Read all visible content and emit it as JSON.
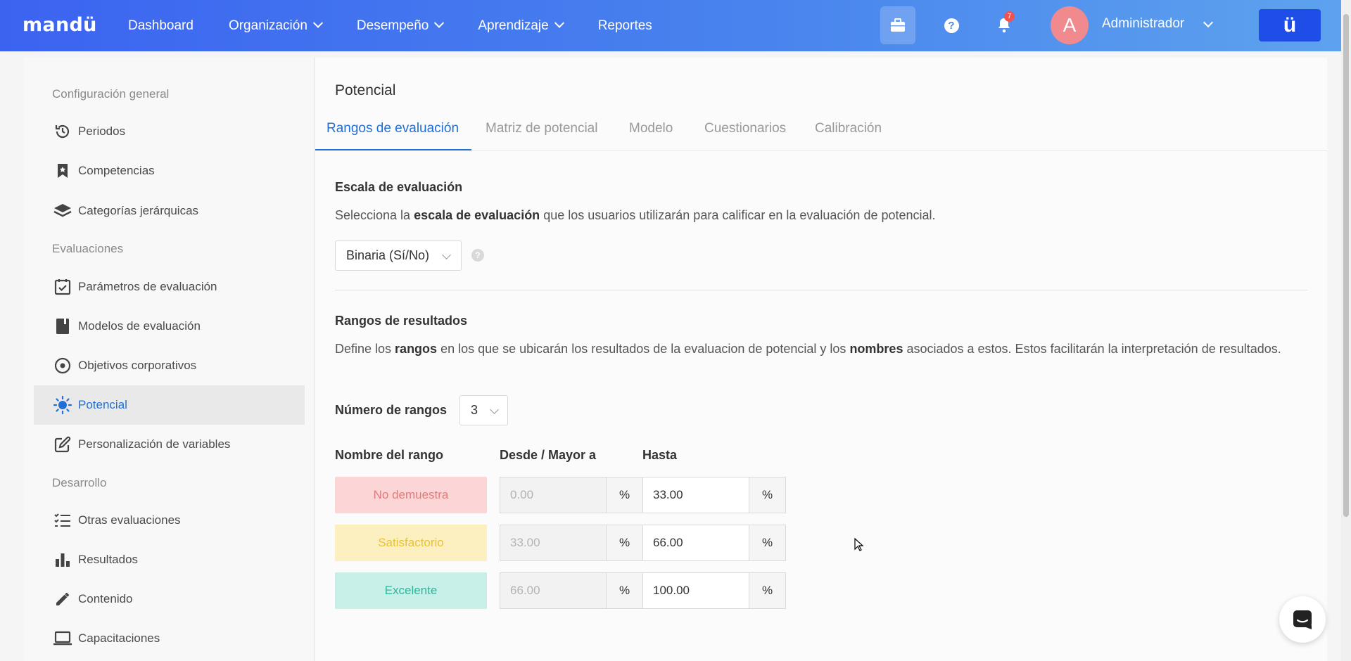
{
  "brand": {
    "logo_text": "mandü",
    "button_glyph": "ü",
    "accent": "#1f6fd6"
  },
  "nav": {
    "items": [
      {
        "label": "Dashboard",
        "has_dropdown": false
      },
      {
        "label": "Organización",
        "has_dropdown": true
      },
      {
        "label": "Desempeño",
        "has_dropdown": true
      },
      {
        "label": "Aprendizaje",
        "has_dropdown": true
      },
      {
        "label": "Reportes",
        "has_dropdown": false
      }
    ],
    "notifications_count": "7",
    "help_glyph": "?",
    "user": {
      "avatar_initial": "A",
      "name": "Administrador"
    }
  },
  "sidebar": {
    "section_general": "Configuración general",
    "general_items": [
      {
        "label": "Periodos",
        "icon": "history-icon"
      },
      {
        "label": "Competencias",
        "icon": "bookmark-icon"
      },
      {
        "label": "Categorías jerárquicas",
        "icon": "layers-icon"
      }
    ],
    "section_evaluaciones": "Evaluaciones",
    "evaluaciones_items": [
      {
        "label": "Parámetros de evaluación",
        "icon": "calendar-check-icon"
      },
      {
        "label": "Modelos de evaluación",
        "icon": "book-icon"
      },
      {
        "label": "Objetivos corporativos",
        "icon": "target-icon"
      },
      {
        "label": "Potencial",
        "icon": "sun-icon",
        "active": true
      },
      {
        "label": "Personalización de variables",
        "icon": "edit-icon"
      }
    ],
    "section_desarrollo": "Desarrollo",
    "desarrollo_items": [
      {
        "label": "Otras evaluaciones",
        "icon": "list-check-icon"
      },
      {
        "label": "Resultados",
        "icon": "bar-chart-icon"
      },
      {
        "label": "Contenido",
        "icon": "pencil-icon"
      },
      {
        "label": "Capacitaciones",
        "icon": "laptop-icon"
      }
    ]
  },
  "main": {
    "title": "Potencial",
    "tabs": [
      {
        "label": "Rangos de evaluación",
        "active": true
      },
      {
        "label": "Matriz de potencial"
      },
      {
        "label": "Modelo"
      },
      {
        "label": "Cuestionarios"
      },
      {
        "label": "Calibración"
      }
    ],
    "scale": {
      "heading": "Escala de evaluación",
      "desc_pre": "Selecciona la ",
      "desc_bold": "escala de evaluación",
      "desc_post": " que los usuarios utilizarán para calificar en la evaluación de potencial.",
      "selected": "Binaria (Sí/No)",
      "help_glyph": "?"
    },
    "ranges": {
      "heading": "Rangos de resultados",
      "desc_1": "Define los ",
      "desc_b1": "rangos",
      "desc_2": " en los que se ubicarán los resultados de la evaluacion de potencial y los ",
      "desc_b2": "nombres",
      "desc_3": " asociados a estos. Estos facilitarán la interpretación de resultados.",
      "count_label": "Número de rangos",
      "count_value": "3",
      "col_name": "Nombre del rango",
      "col_from": "Desde / Mayor a",
      "col_to": "Hasta",
      "unit": "%",
      "rows": [
        {
          "name": "No demuestra",
          "from": "0.00",
          "to": "33.00",
          "bg": "#fcd6d6",
          "fg": "#e07c7c"
        },
        {
          "name": "Satisfactorio",
          "from": "33.00",
          "to": "66.00",
          "bg": "#fcf0c0",
          "fg": "#e8c13a"
        },
        {
          "name": "Excelente",
          "from": "66.00",
          "to": "100.00",
          "bg": "#c9f0e8",
          "fg": "#2fb59a"
        }
      ]
    }
  }
}
